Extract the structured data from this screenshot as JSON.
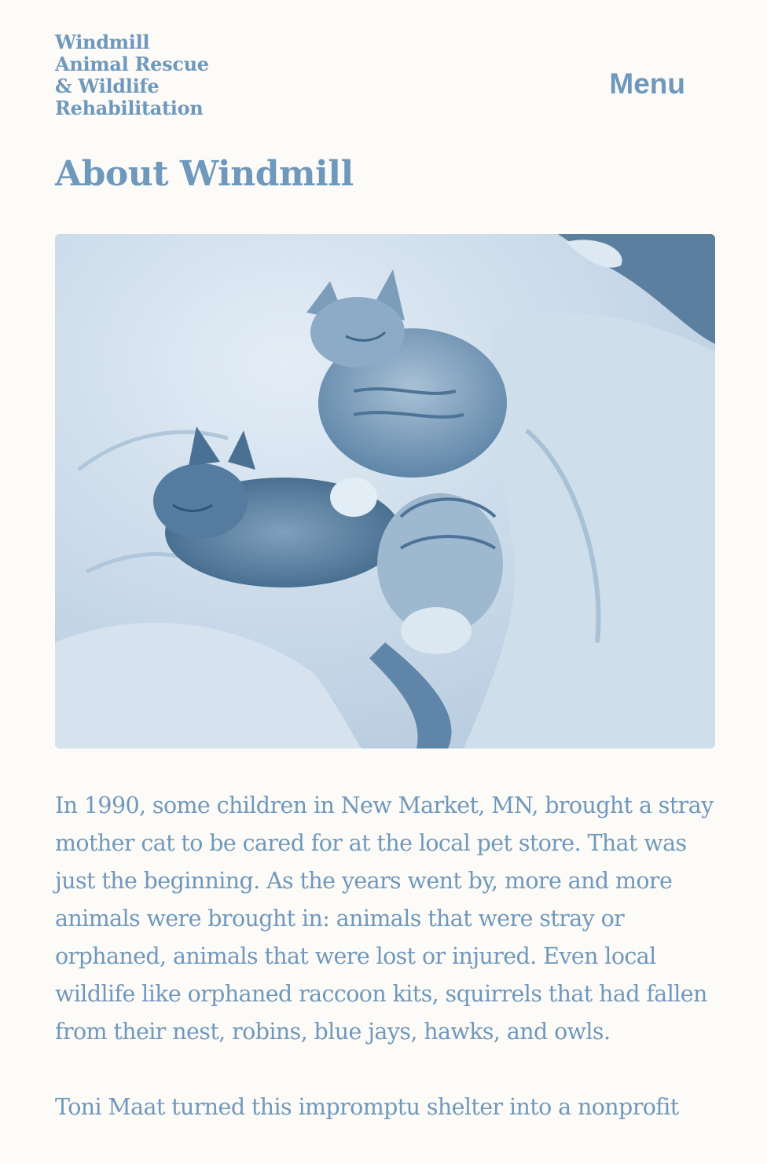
{
  "header": {
    "site_title_lines": [
      "Windmill",
      "Animal Rescue",
      "& Wildlife",
      "Rehabilitation"
    ],
    "menu_label": "Menu"
  },
  "main": {
    "page_title": "About Windmill",
    "hero_image": {
      "subject": "kittens sleeping on a blanket",
      "tint": "#6f98bd"
    },
    "paragraphs": [
      "In 1990, some children in New Market, MN, brought a stray mother cat to be cared for at the local pet store. That was just the beginning. As the years went by, more and more animals were brought in: animals that were stray or orphaned, animals that were lost or injured. Even local wildlife like orphaned raccoon kits, squirrels that had fallen from their nest, robins, blue jays, hawks, and owls.",
      "Toni Maat turned this impromptu shelter into a nonprofit"
    ]
  },
  "colors": {
    "background": "#fdfbf7",
    "accent": "#6f98bd"
  }
}
